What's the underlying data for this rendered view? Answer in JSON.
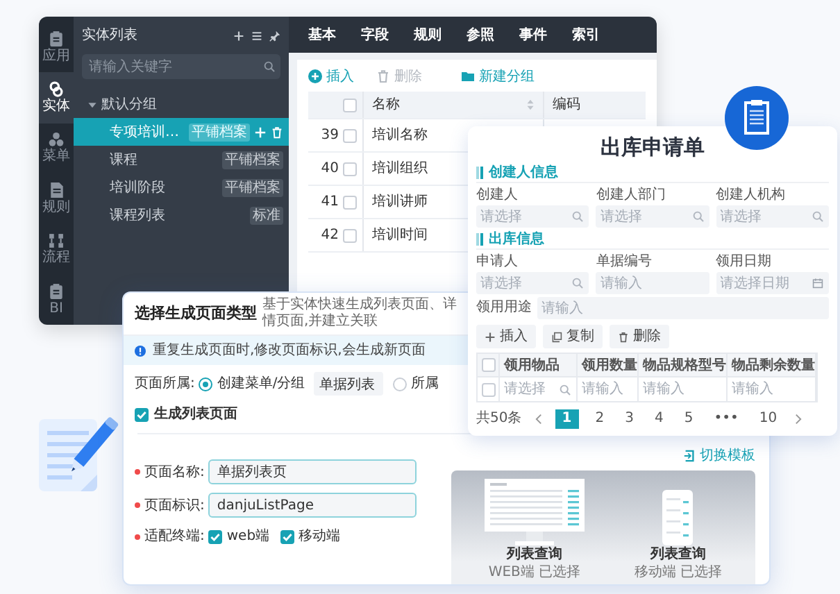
{
  "app_window": {
    "sidebar": {
      "items": [
        {
          "label": "应用",
          "selected": false
        },
        {
          "label": "实体",
          "selected": true
        },
        {
          "label": "菜单",
          "selected": false
        },
        {
          "label": "规则",
          "selected": false
        },
        {
          "label": "流程",
          "selected": false
        },
        {
          "label": "BI",
          "selected": false
        }
      ]
    },
    "entity_panel": {
      "title": "实体列表",
      "search": {
        "placeholder": "请输入关键字"
      },
      "tree": [
        {
          "label": "默认分组",
          "expanded": true,
          "children": [
            {
              "label": "专项培训…",
              "tag": "平铺档案",
              "selected": true
            },
            {
              "label": "课程",
              "tag": "平铺档案",
              "selected": false
            },
            {
              "label": "培训阶段",
              "tag": "平铺档案",
              "selected": false
            },
            {
              "label": "课程列表",
              "tag": "标准",
              "selected": false
            }
          ]
        }
      ]
    },
    "tabs": [
      "基本",
      "字段",
      "规则",
      "参照",
      "事件",
      "索引"
    ],
    "toolbar": [
      {
        "label": "插入",
        "kind": "add",
        "disabled": false
      },
      {
        "label": "删除",
        "kind": "delete",
        "disabled": true
      },
      {
        "label": "新建分组",
        "kind": "folder",
        "disabled": false
      }
    ],
    "table": {
      "columns": [
        "名称",
        "编码"
      ],
      "all_checked": false,
      "rows": [
        {
          "index": "39",
          "name": "培训名称",
          "checked": false
        },
        {
          "index": "40",
          "name": "培训组织",
          "checked": false
        },
        {
          "index": "41",
          "name": "培训讲师",
          "checked": false
        },
        {
          "index": "42",
          "name": "培训时间",
          "checked": false
        }
      ]
    }
  },
  "form_card": {
    "title": "出库申请单",
    "sections": [
      {
        "title": "创建人信息",
        "rows": [
          [
            {
              "label": "创建人",
              "placeholder": "请选择",
              "kind": "select"
            },
            {
              "label": "创建人部门",
              "placeholder": "请选择",
              "kind": "select"
            },
            {
              "label": "创建人机构",
              "placeholder": "请选择",
              "kind": "select"
            }
          ]
        ]
      },
      {
        "title": "出库信息",
        "rows": [
          [
            {
              "label": "申请人",
              "placeholder": "请选择",
              "kind": "select"
            },
            {
              "label": "单据编号",
              "placeholder": "请输入",
              "kind": "text"
            },
            {
              "label": "领用日期",
              "placeholder": "请选择日期",
              "kind": "date"
            }
          ],
          [
            {
              "label": "领用用途",
              "placeholder": "请输入",
              "kind": "text"
            }
          ]
        ]
      }
    ],
    "buttons": [
      {
        "label": "插入",
        "kind": "add"
      },
      {
        "label": "复制",
        "kind": "copy"
      },
      {
        "label": "删除",
        "kind": "delete"
      }
    ],
    "table": {
      "columns": [
        "领用物品",
        "领用数量",
        "物品规格型号",
        "物品剩余数量"
      ],
      "all_checked": false,
      "rows": [
        {
          "checked": false,
          "cells": [
            {
              "placeholder": "请选择",
              "kind": "select"
            },
            {
              "placeholder": "请输入",
              "kind": "text"
            },
            {
              "placeholder": "请输入",
              "kind": "text"
            },
            {
              "placeholder": "请输入",
              "kind": "text"
            }
          ]
        }
      ]
    },
    "pagination": {
      "total": "共50条",
      "pages": [
        {
          "label": "1",
          "selected": true
        },
        {
          "label": "2",
          "selected": false
        },
        {
          "label": "3",
          "selected": false
        },
        {
          "label": "4",
          "selected": false
        },
        {
          "label": "5",
          "selected": false
        },
        {
          "label": "•••",
          "selected": false
        },
        {
          "label": "10",
          "selected": false
        }
      ]
    }
  },
  "dialog": {
    "title": "选择生成页面类型",
    "subtitle": "基于实体快速生成列表页面、详情页面,并建立关联",
    "notice": "重复生成页面时,修改页面标识,会生成新页面",
    "page_owner": {
      "label": "页面所属:",
      "options": [
        {
          "label": "创建菜单/分组",
          "selected": true,
          "value": "单据列表"
        },
        {
          "label": "所属",
          "selected": false
        }
      ]
    },
    "generate_list": {
      "label": "生成列表页面",
      "checked": true
    },
    "fields": [
      {
        "label": "页面名称:",
        "required": true,
        "value": "单据列表页"
      },
      {
        "label": "页面标识:",
        "required": true,
        "value": "danjuListPage"
      }
    ],
    "terminals": {
      "label": "适配终端:",
      "required": true,
      "options": [
        {
          "label": "web端",
          "checked": true
        },
        {
          "label": "移动端",
          "checked": true
        }
      ]
    },
    "switch_template": "切换模板",
    "templates": [
      {
        "kind": "web",
        "title": "列表查询",
        "status": "WEB端 已选择"
      },
      {
        "kind": "mobile",
        "title": "列表查询",
        "status": "移动端 已选择"
      }
    ]
  }
}
